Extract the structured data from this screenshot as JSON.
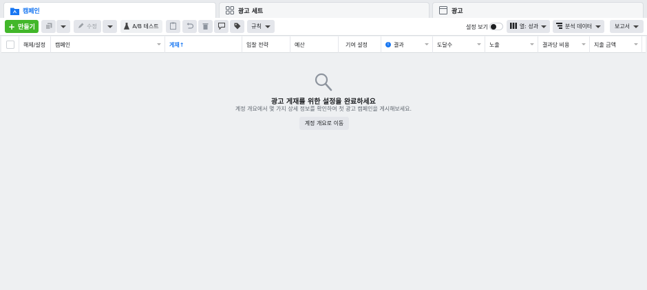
{
  "tabs": [
    {
      "label": "캠페인",
      "icon": "folder-icon",
      "active": true
    },
    {
      "label": "광고 세트",
      "icon": "grid-icon",
      "active": false
    },
    {
      "label": "광고",
      "icon": "ad-icon",
      "active": false
    }
  ],
  "toolbar": {
    "create_label": "만들기",
    "edit_label": "수정",
    "ab_test_label": "A/B 테스트",
    "rules_label": "규칙",
    "settings_view_label": "설정 보기",
    "columns_label": "열: 성과",
    "breakdown_label": "분석 데이터",
    "reports_label": "보고서"
  },
  "table": {
    "columns": [
      "해제/설정",
      "캠페인",
      "게재↑",
      "입찰 전략",
      "예산",
      "기여 설정",
      "결과",
      "도달수",
      "노출",
      "결과당 비용",
      "지출 금액"
    ]
  },
  "empty_state": {
    "title": "광고 게재를 위한 설정을 완료하세요",
    "subtitle": "계정 개요에서 몇 가지 상세 정보를 확인하여 첫 광고 캠페인을 게시해보세요.",
    "button_label": "계정 개요로 이동"
  },
  "colors": {
    "accent": "#1877f2",
    "create": "#42b72a",
    "background": "#eef0f2"
  }
}
